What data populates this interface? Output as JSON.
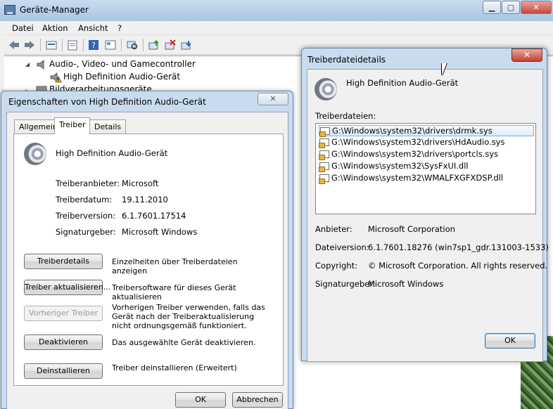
{
  "main_window": {
    "title": "Geräte-Manager",
    "menu": [
      "Datei",
      "Aktion",
      "Ansicht",
      "?"
    ],
    "tree": [
      {
        "label": "Audio-, Video- und Gamecontroller"
      },
      {
        "label": "High Definition Audio-Gerät"
      },
      {
        "label": "Bildverarbeitungsgeräte"
      }
    ]
  },
  "props_dialog": {
    "title": "Eigenschaften von High Definition Audio-Gerät",
    "close_glyph": "✕",
    "tabs": [
      "Allgemein",
      "Treiber",
      "Details"
    ],
    "active_tab": "Treiber",
    "device_name": "High Definition Audio-Gerät",
    "fields": [
      {
        "label": "Treiberanbieter:",
        "value": "Microsoft"
      },
      {
        "label": "Treiberdatum:",
        "value": "19.11.2010"
      },
      {
        "label": "Treiberversion:",
        "value": "6.1.7601.17514"
      },
      {
        "label": "Signaturgeber:",
        "value": "Microsoft Windows"
      }
    ],
    "actions": [
      {
        "button": "Treiberdetails",
        "description": "Einzelheiten über Treiberdateien anzeigen",
        "enabled": true
      },
      {
        "button": "Treiber aktualisieren...",
        "description": "Treibersoftware für dieses Gerät aktualisieren",
        "enabled": true
      },
      {
        "button": "Vorheriger Treiber",
        "description": "Vorherigen Treiber verwenden, falls das Gerät nach der Treiberaktualisierung nicht ordnungsgemäß funktioniert.",
        "enabled": false
      },
      {
        "button": "Deaktivieren",
        "description": "Das ausgewählte Gerät deaktivieren.",
        "enabled": true
      },
      {
        "button": "Deinstallieren",
        "description": "Treiber deinstallieren (Erweitert)",
        "enabled": true
      }
    ],
    "ok_label": "OK",
    "cancel_label": "Abbrechen"
  },
  "details_dialog": {
    "title": "Treiberdateidetails",
    "close_glyph": "✕",
    "device_name": "High Definition Audio-Gerät",
    "files_label": "Treiberdateien:",
    "files": [
      "G:\\Windows\\system32\\drivers\\drmk.sys",
      "G:\\Windows\\system32\\drivers\\HdAudio.sys",
      "G:\\Windows\\system32\\drivers\\portcls.sys",
      "G:\\Windows\\system32\\SysFxUI.dll",
      "G:\\Windows\\system32\\WMALFXGFXDSP.dll"
    ],
    "selected_file_index": 0,
    "info": [
      {
        "label": "Anbieter:",
        "value": "Microsoft Corporation"
      },
      {
        "label": "Dateiversion:",
        "value": "6.1.7601.18276 (win7sp1_gdr.131003-1533)"
      },
      {
        "label": "Copyright:",
        "value": "© Microsoft Corporation. All rights reserved."
      },
      {
        "label": "Signaturgeber:",
        "value": "Microsoft Windows"
      }
    ],
    "ok_label": "OK"
  }
}
